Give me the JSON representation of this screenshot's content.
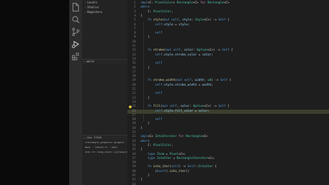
{
  "colors": {
    "background": "#1e1e1e",
    "sidebar": "#232323",
    "activity_bar": "#2c2c2c",
    "highlight": "#3b3f2e",
    "breakpoint": "#e0c341"
  },
  "activity": [
    {
      "name": "files-icon"
    },
    {
      "name": "search-icon"
    },
    {
      "name": "source-control-icon"
    },
    {
      "name": "run-debug-icon"
    },
    {
      "name": "extensions-icon"
    }
  ],
  "variables": [
    "Locals",
    "Statics",
    "Registers"
  ],
  "sections": {
    "watch": "WATCH",
    "call_stack": "CALL STACK"
  },
  "call_stack": [
    {
      "label": "<rectangle_graphics::graphic",
      "line": ""
    },
    {
      "label": "main  ·  libstd_rt · main",
      "line": ""
    },
    {
      "label": "std::rt::lang_start::{{closure}}",
      "line": ""
    }
  ],
  "editor": {
    "start_line": 1,
    "lines": [
      [
        [
          "t-kw",
          "impl"
        ],
        [
          "t-pun",
          "<C: "
        ],
        [
          "t-ty",
          "PixelColor"
        ],
        [
          "t-pun",
          "> "
        ],
        [
          "t-ty",
          "Rectangle"
        ],
        [
          "t-pun",
          "<C> "
        ],
        [
          "t-ctl",
          "for"
        ],
        [
          "t-pun",
          " "
        ],
        [
          "t-ty",
          "Rectangle"
        ],
        [
          "t-pun",
          "<C>"
        ]
      ],
      [
        [
          "t-kw",
          "where"
        ]
      ],
      [
        [
          "t-pun",
          "    C: "
        ],
        [
          "t-ty",
          "PixelColor"
        ],
        [
          "t-pun",
          ","
        ]
      ],
      [
        [
          "t-pun",
          "{"
        ]
      ],
      [
        [
          "t-pun",
          "    "
        ],
        [
          "t-kw",
          "fn"
        ],
        [
          "t-pun",
          " "
        ],
        [
          "t-fn",
          "style"
        ],
        [
          "t-pun",
          "("
        ],
        [
          "t-kw",
          "mut"
        ],
        [
          "t-pun",
          " "
        ],
        [
          "t-kw",
          "self"
        ],
        [
          "t-pun",
          ", "
        ],
        [
          "t-var",
          "style"
        ],
        [
          "t-pun",
          ": "
        ],
        [
          "t-ty",
          "Style"
        ],
        [
          "t-pun",
          "<C>) -> "
        ],
        [
          "t-kw",
          "Self"
        ],
        [
          "t-pun",
          " {"
        ]
      ],
      [
        [
          "t-pun",
          "        "
        ],
        [
          "t-kw",
          "self"
        ],
        [
          "t-pun",
          "."
        ],
        [
          "t-var",
          "style"
        ],
        [
          "t-pun",
          " = "
        ],
        [
          "t-var",
          "style"
        ],
        [
          "t-pun",
          ";"
        ]
      ],
      [
        [
          "t-pun",
          ""
        ]
      ],
      [
        [
          "t-pun",
          "        "
        ],
        [
          "t-kw",
          "self"
        ]
      ],
      [
        [
          "t-pun",
          "    }"
        ]
      ],
      [
        [
          "t-pun",
          ""
        ]
      ],
      [
        [
          "t-pun",
          ""
        ]
      ],
      [
        [
          "t-pun",
          "    "
        ],
        [
          "t-kw",
          "fn"
        ],
        [
          "t-pun",
          " "
        ],
        [
          "t-fn",
          "stroke"
        ],
        [
          "t-pun",
          "("
        ],
        [
          "t-kw",
          "mut"
        ],
        [
          "t-pun",
          " "
        ],
        [
          "t-kw",
          "self"
        ],
        [
          "t-pun",
          ", "
        ],
        [
          "t-var",
          "color"
        ],
        [
          "t-pun",
          ": "
        ],
        [
          "t-ty",
          "Option"
        ],
        [
          "t-pun",
          "<C>) -> "
        ],
        [
          "t-kw",
          "Self"
        ],
        [
          "t-pun",
          " {"
        ]
      ],
      [
        [
          "t-pun",
          "        "
        ],
        [
          "t-kw",
          "self"
        ],
        [
          "t-pun",
          "."
        ],
        [
          "t-var",
          "style"
        ],
        [
          "t-pun",
          "."
        ],
        [
          "t-var",
          "stroke_color"
        ],
        [
          "t-pun",
          " = "
        ],
        [
          "t-var",
          "color"
        ],
        [
          "t-pun",
          ";"
        ]
      ],
      [
        [
          "t-pun",
          ""
        ]
      ],
      [
        [
          "t-pun",
          "        "
        ],
        [
          "t-kw",
          "self"
        ]
      ],
      [
        [
          "t-pun",
          "    }"
        ]
      ],
      [
        [
          "t-pun",
          ""
        ]
      ],
      [
        [
          "t-pun",
          ""
        ]
      ],
      [
        [
          "t-pun",
          "    "
        ],
        [
          "t-kw",
          "fn"
        ],
        [
          "t-pun",
          " "
        ],
        [
          "t-fn",
          "stroke_width"
        ],
        [
          "t-pun",
          "("
        ],
        [
          "t-kw",
          "mut"
        ],
        [
          "t-pun",
          " "
        ],
        [
          "t-kw",
          "self"
        ],
        [
          "t-pun",
          ", "
        ],
        [
          "t-var",
          "width"
        ],
        [
          "t-pun",
          ": "
        ],
        [
          "t-ty",
          "u8"
        ],
        [
          "t-pun",
          ") -> "
        ],
        [
          "t-kw",
          "Self"
        ],
        [
          "t-pun",
          " {"
        ]
      ],
      [
        [
          "t-pun",
          "        "
        ],
        [
          "t-kw",
          "self"
        ],
        [
          "t-pun",
          "."
        ],
        [
          "t-var",
          "style"
        ],
        [
          "t-pun",
          "."
        ],
        [
          "t-var",
          "stroke_width"
        ],
        [
          "t-pun",
          " = "
        ],
        [
          "t-var",
          "width"
        ],
        [
          "t-pun",
          ";"
        ]
      ],
      [
        [
          "t-pun",
          ""
        ]
      ],
      [
        [
          "t-pun",
          "        "
        ],
        [
          "t-kw",
          "self"
        ]
      ],
      [
        [
          "t-pun",
          "    }"
        ]
      ],
      [
        [
          "t-pun",
          ""
        ]
      ],
      [
        [
          "t-pun",
          "    "
        ],
        [
          "t-kw",
          "fn"
        ],
        [
          "t-pun",
          " "
        ],
        [
          "t-fn",
          "fill"
        ],
        [
          "t-pun",
          "("
        ],
        [
          "t-kw",
          "mut"
        ],
        [
          "t-pun",
          " "
        ],
        [
          "t-kw",
          "self"
        ],
        [
          "t-pun",
          ", "
        ],
        [
          "t-var",
          "color"
        ],
        [
          "t-pun",
          ": "
        ],
        [
          "t-ty",
          "Option"
        ],
        [
          "t-pun",
          "<C>) -> "
        ],
        [
          "t-kw",
          "Self"
        ],
        [
          "t-pun",
          " {"
        ]
      ],
      [
        [
          "t-pun",
          "        "
        ],
        [
          "t-kw",
          "self"
        ],
        [
          "t-pun",
          "."
        ],
        [
          "t-var",
          "style"
        ],
        [
          "t-pun",
          "."
        ],
        [
          "t-var",
          "fill_color"
        ],
        [
          "t-pun",
          " = "
        ],
        [
          "t-var",
          "color"
        ],
        [
          "t-pun",
          ";"
        ]
      ],
      [
        [
          "t-pun",
          ""
        ]
      ],
      [
        [
          "t-pun",
          "        "
        ],
        [
          "t-kw",
          "self"
        ]
      ],
      [
        [
          "t-pun",
          "    }"
        ]
      ],
      [
        [
          "t-pun",
          "}"
        ]
      ],
      [
        [
          "t-pun",
          ""
        ]
      ],
      [
        [
          "t-kw",
          "impl"
        ],
        [
          "t-pun",
          "<C> "
        ],
        [
          "t-ty",
          "IntoIterator"
        ],
        [
          "t-pun",
          " "
        ],
        [
          "t-ctl",
          "for"
        ],
        [
          "t-pun",
          " "
        ],
        [
          "t-ty",
          "Rectangle"
        ],
        [
          "t-pun",
          "<C>"
        ]
      ],
      [
        [
          "t-kw",
          "where"
        ]
      ],
      [
        [
          "t-pun",
          "    C: "
        ],
        [
          "t-ty",
          "PixelColor"
        ],
        [
          "t-pun",
          ","
        ]
      ],
      [
        [
          "t-pun",
          "{"
        ]
      ],
      [
        [
          "t-pun",
          "    "
        ],
        [
          "t-kw",
          "type"
        ],
        [
          "t-pun",
          " "
        ],
        [
          "t-ty",
          "Item"
        ],
        [
          "t-pun",
          " = "
        ],
        [
          "t-ty",
          "Pixel"
        ],
        [
          "t-pun",
          "<C>;"
        ]
      ],
      [
        [
          "t-pun",
          "    "
        ],
        [
          "t-kw",
          "type"
        ],
        [
          "t-pun",
          " "
        ],
        [
          "t-ty",
          "IntoIter"
        ],
        [
          "t-pun",
          " = "
        ],
        [
          "t-ty",
          "RectangleIterator"
        ],
        [
          "t-pun",
          "<C>;"
        ]
      ],
      [
        [
          "t-pun",
          ""
        ]
      ],
      [
        [
          "t-pun",
          "    "
        ],
        [
          "t-kw",
          "fn"
        ],
        [
          "t-pun",
          " "
        ],
        [
          "t-fn",
          "into_iter"
        ],
        [
          "t-pun",
          "("
        ],
        [
          "t-kw",
          "self"
        ],
        [
          "t-pun",
          ") -> "
        ],
        [
          "t-kw",
          "Self"
        ],
        [
          "t-pun",
          "::"
        ],
        [
          "t-ty",
          "IntoIter"
        ],
        [
          "t-pun",
          " {"
        ]
      ],
      [
        [
          "t-pun",
          "        ("
        ],
        [
          "t-kw",
          "&self"
        ],
        [
          "t-pun",
          ")."
        ],
        [
          "t-fn",
          "into_iter"
        ],
        [
          "t-pun",
          "()"
        ]
      ],
      [
        [
          "t-pun",
          "    }"
        ]
      ],
      [
        [
          "t-pun",
          "}"
        ]
      ],
      [
        [
          "t-pun",
          ""
        ]
      ],
      [
        [
          "t-kw",
          "impl"
        ],
        [
          "t-pun",
          "<'a, C> "
        ],
        [
          "t-ty",
          "IntoIterator"
        ],
        [
          "t-pun",
          " "
        ],
        [
          "t-ctl",
          "for"
        ],
        [
          "t-pun",
          " &'a "
        ],
        [
          "t-ty",
          "Rectangle"
        ],
        [
          "t-pun",
          "<C>"
        ]
      ]
    ],
    "highlight_line": 26,
    "breakpoint_line": 25
  }
}
